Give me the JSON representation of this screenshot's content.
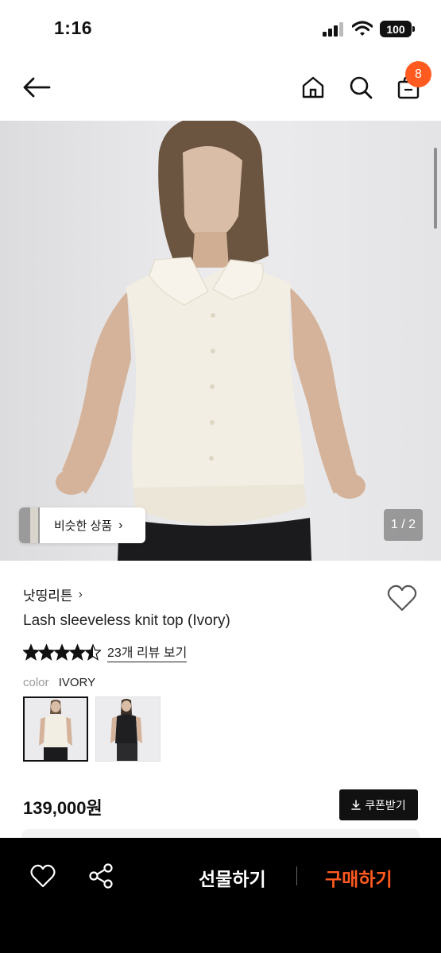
{
  "status_bar": {
    "time": "1:16",
    "battery": "100",
    "icons": [
      "signal-icon",
      "wifi-icon",
      "battery-icon"
    ]
  },
  "top_nav": {
    "icons": [
      "back-arrow-icon",
      "home-icon",
      "search-icon",
      "shopping-bag-icon"
    ],
    "cart_count": "8",
    "badge_color": "#ff5a1f"
  },
  "gallery": {
    "similar_label": "비슷한 상품",
    "page_counter": "1 / 2"
  },
  "product": {
    "brand": "낫띵리튼",
    "title": "Lash sleeveless knit top (Ivory)",
    "rating": 4.5,
    "review_link": "23개 리뷰 보기",
    "color_label": "color",
    "color_value": "IVORY",
    "swatches": [
      "Ivory",
      "Black"
    ],
    "price": "139,000원",
    "coupon_label": "쿠폰받기"
  },
  "bottom_bar": {
    "icons": [
      "heart-icon",
      "share-icon"
    ],
    "gift_label": "선물하기",
    "buy_label": "구매하기",
    "buy_color": "#ff5a1f"
  }
}
